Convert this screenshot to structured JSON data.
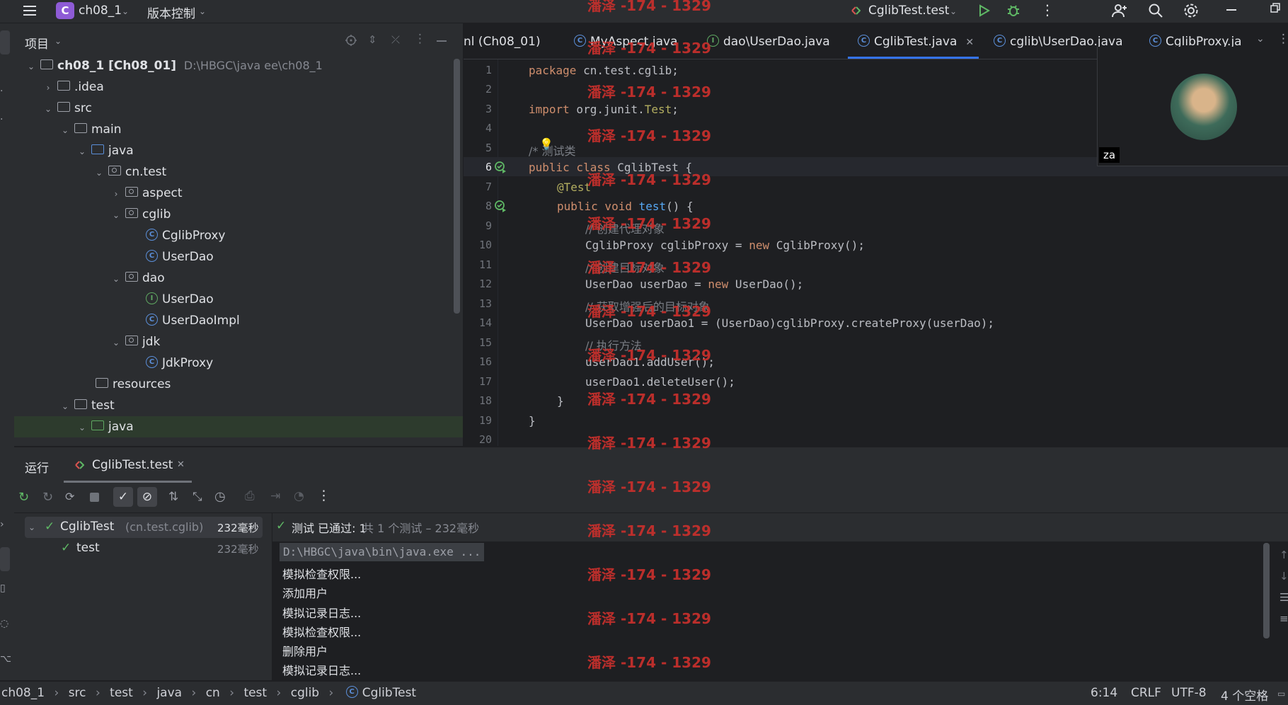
{
  "titlebar": {
    "project_initial": "C",
    "project_name": "ch08_1",
    "vcs_label": "版本控制",
    "run_config": "CglibTest.test"
  },
  "project_panel": {
    "title": "项目",
    "tree": [
      {
        "label": "ch08_1 [Ch08_01]",
        "extra": "D:\\HBGC\\java ee\\ch08_1"
      },
      {
        "label": ".idea"
      },
      {
        "label": "src"
      },
      {
        "label": "main"
      },
      {
        "label": "java"
      },
      {
        "label": "cn.test"
      },
      {
        "label": "aspect"
      },
      {
        "label": "cglib"
      },
      {
        "label": "CglibProxy"
      },
      {
        "label": "UserDao"
      },
      {
        "label": "dao"
      },
      {
        "label": "UserDao"
      },
      {
        "label": "UserDaoImpl"
      },
      {
        "label": "jdk"
      },
      {
        "label": "JdkProxy"
      },
      {
        "label": "resources"
      },
      {
        "label": "test"
      },
      {
        "label": "java"
      }
    ]
  },
  "tabs": [
    {
      "label": "nl (Ch08_01)"
    },
    {
      "label": "MyAspect.java"
    },
    {
      "label": "dao\\UserDao.java"
    },
    {
      "label": "CglibTest.java"
    },
    {
      "label": "cglib\\UserDao.java"
    },
    {
      "label": "CglibProxy.ja"
    }
  ],
  "editor": {
    "line_numbers": [
      "1",
      "2",
      "3",
      "4",
      "5",
      "6",
      "7",
      "8",
      "9",
      "10",
      "11",
      "12",
      "13",
      "14",
      "15",
      "16",
      "17",
      "18",
      "19",
      "20"
    ],
    "lines": {
      "l1_kw": "package",
      "l1_rest": " cn.test.cglib;",
      "l3_kw": "import",
      "l3_a": " org.junit.",
      "l3_b": "Test",
      "l3_c": ";",
      "l5": "/* 测试类",
      "l6_kw": "public class",
      "l6_rest": " CglibTest {",
      "l7": "@Test",
      "l8_kw": "public void",
      "l8_fn": " test",
      "l8_rest": "() {",
      "l9": "// 创建代理对象",
      "l10_a": "CglibProxy cglibProxy = ",
      "l10_kw": "new",
      "l10_b": " CglibProxy();",
      "l11": "// 创建目标对象",
      "l12_a": "UserDao userDao = ",
      "l12_kw": "new",
      "l12_b": " UserDao();",
      "l13": "// 获取增强后的目标对象",
      "l14": "UserDao userDao1 = (UserDao)cglibProxy.createProxy(userDao);",
      "l15": "// 执行方法",
      "l16": "userDao1.addUser();",
      "l17": "userDao1.deleteUser();",
      "l18": "}",
      "l19": "}"
    }
  },
  "video_overlay": {
    "label": "za"
  },
  "watermark": "潘泽 -174 - 1329",
  "run_panel": {
    "title": "运行",
    "tab": "CglibTest.test",
    "tree": [
      {
        "label": "CglibTest",
        "pkg": "(cn.test.cglib)",
        "time": "232毫秒"
      },
      {
        "label": "test",
        "time": "232毫秒"
      }
    ],
    "status_pass": "测试 已通过: 1",
    "status_detail": "共 1 个测试 – 232毫秒",
    "console_lines": [
      "D:\\HBGC\\java\\bin\\java.exe ...",
      "模拟检查权限...",
      "添加用户",
      "模拟记录日志...",
      "模拟检查权限...",
      "删除用户",
      "模拟记录日志..."
    ]
  },
  "statusbar": {
    "breadcrumb": [
      "ch08_1",
      "src",
      "test",
      "java",
      "cn",
      "test",
      "cglib",
      "CglibTest"
    ],
    "position": "6:14",
    "line_sep": "CRLF",
    "encoding": "UTF-8",
    "indent": "4 个空格"
  }
}
